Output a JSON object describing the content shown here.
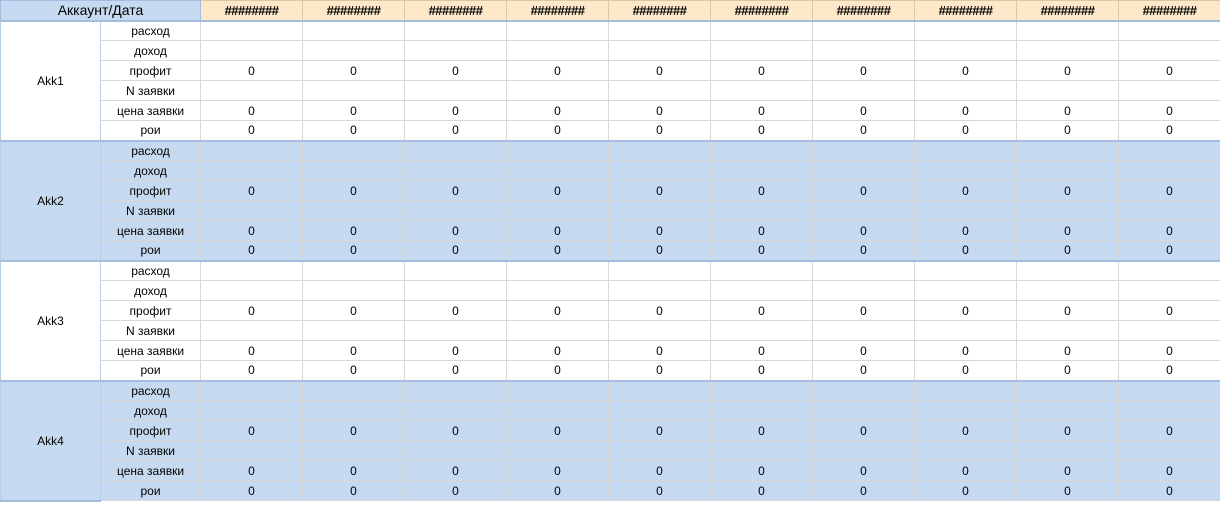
{
  "header": {
    "account_label": "Аккаунт/Дата",
    "date_cols": [
      "########",
      "########",
      "########",
      "########",
      "########",
      "########",
      "########",
      "########",
      "########",
      "########"
    ]
  },
  "metrics": [
    "расход",
    "доход",
    "профит",
    "N заявки",
    "цена заявки",
    "рои"
  ],
  "accounts": [
    {
      "name": "Akk1",
      "shaded": false,
      "rows": [
        [
          "",
          "",
          "",
          "",
          "",
          "",
          "",
          "",
          "",
          ""
        ],
        [
          "",
          "",
          "",
          "",
          "",
          "",
          "",
          "",
          "",
          ""
        ],
        [
          "0",
          "0",
          "0",
          "0",
          "0",
          "0",
          "0",
          "0",
          "0",
          "0"
        ],
        [
          "",
          "",
          "",
          "",
          "",
          "",
          "",
          "",
          "",
          ""
        ],
        [
          "0",
          "0",
          "0",
          "0",
          "0",
          "0",
          "0",
          "0",
          "0",
          "0"
        ],
        [
          "0",
          "0",
          "0",
          "0",
          "0",
          "0",
          "0",
          "0",
          "0",
          "0"
        ]
      ]
    },
    {
      "name": "Akk2",
      "shaded": true,
      "rows": [
        [
          "",
          "",
          "",
          "",
          "",
          "",
          "",
          "",
          "",
          ""
        ],
        [
          "",
          "",
          "",
          "",
          "",
          "",
          "",
          "",
          "",
          ""
        ],
        [
          "0",
          "0",
          "0",
          "0",
          "0",
          "0",
          "0",
          "0",
          "0",
          "0"
        ],
        [
          "",
          "",
          "",
          "",
          "",
          "",
          "",
          "",
          "",
          ""
        ],
        [
          "0",
          "0",
          "0",
          "0",
          "0",
          "0",
          "0",
          "0",
          "0",
          "0"
        ],
        [
          "0",
          "0",
          "0",
          "0",
          "0",
          "0",
          "0",
          "0",
          "0",
          "0"
        ]
      ]
    },
    {
      "name": "Akk3",
      "shaded": false,
      "rows": [
        [
          "",
          "",
          "",
          "",
          "",
          "",
          "",
          "",
          "",
          ""
        ],
        [
          "",
          "",
          "",
          "",
          "",
          "",
          "",
          "",
          "",
          ""
        ],
        [
          "0",
          "0",
          "0",
          "0",
          "0",
          "0",
          "0",
          "0",
          "0",
          "0"
        ],
        [
          "",
          "",
          "",
          "",
          "",
          "",
          "",
          "",
          "",
          ""
        ],
        [
          "0",
          "0",
          "0",
          "0",
          "0",
          "0",
          "0",
          "0",
          "0",
          "0"
        ],
        [
          "0",
          "0",
          "0",
          "0",
          "0",
          "0",
          "0",
          "0",
          "0",
          "0"
        ]
      ]
    },
    {
      "name": "Akk4",
      "shaded": true,
      "rows": [
        [
          "",
          "",
          "",
          "",
          "",
          "",
          "",
          "",
          "",
          ""
        ],
        [
          "",
          "",
          "",
          "",
          "",
          "",
          "",
          "",
          "",
          ""
        ],
        [
          "0",
          "0",
          "0",
          "0",
          "0",
          "0",
          "0",
          "0",
          "0",
          "0"
        ],
        [
          "",
          "",
          "",
          "",
          "",
          "",
          "",
          "",
          "",
          ""
        ],
        [
          "0",
          "0",
          "0",
          "0",
          "0",
          "0",
          "0",
          "0",
          "0",
          "0"
        ],
        [
          "0",
          "0",
          "0",
          "0",
          "0",
          "0",
          "0",
          "0",
          "0",
          "0"
        ]
      ]
    }
  ]
}
